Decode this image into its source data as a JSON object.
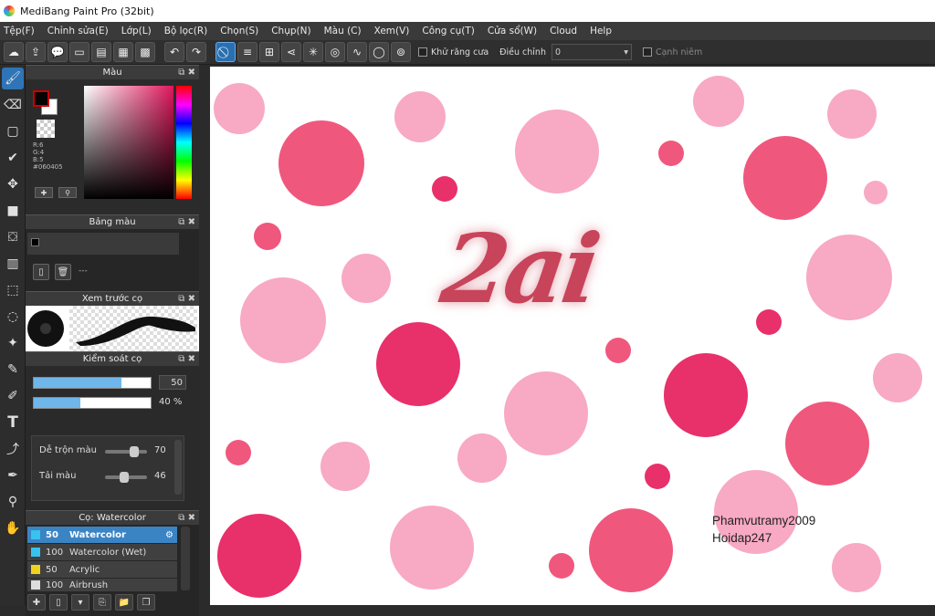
{
  "window": {
    "title": "MediBang Paint Pro (32bit)"
  },
  "menu": [
    "Tệp(F)",
    "Chỉnh sửa(E)",
    "Lớp(L)",
    "Bộ lọc(R)",
    "Chọn(S)",
    "Chụp(N)",
    "Màu (C)",
    "Xem(V)",
    "Công cụ(T)",
    "Cửa sổ(W)",
    "Cloud",
    "Help"
  ],
  "toolbar": {
    "antialias_label": "Khử răng cưa",
    "adjust_label": "Điều chỉnh",
    "adjust_value": "0",
    "edge_label": "Cạnh niêm"
  },
  "panels": {
    "color": {
      "title": "Màu",
      "r": "R:6",
      "g": "G:4",
      "b": "B:5",
      "hex": "#060405",
      "fg": "#060405",
      "bg": "#ffffff"
    },
    "palette": {
      "title": "Bảng màu",
      "dash": "---"
    },
    "brush_preview": {
      "title": "Xem trước cọ"
    },
    "brush_control": {
      "title": "Kiểm soát cọ",
      "size_value": "50",
      "opacity_value": "40 %",
      "size_fraction": 0.75,
      "opacity_fraction": 0.4,
      "blend_label": "Dễ trộn màu",
      "blend_value": "70",
      "blend_fraction": 0.7,
      "reload_label": "Tải màu",
      "reload_value": "46",
      "reload_fraction": 0.46
    },
    "brushes": {
      "title": "Cọ: Watercolor",
      "items": [
        {
          "size": "50",
          "name": "Watercolor",
          "color": "#37c2ef"
        },
        {
          "size": "100",
          "name": "Watercolor (Wet)",
          "color": "#37c2ef"
        },
        {
          "size": "50",
          "name": "Acrylic",
          "color": "#f0d21e"
        },
        {
          "size": "100",
          "name": "Airbrush",
          "color": "#dddddd"
        }
      ]
    }
  },
  "canvas": {
    "lettering": "2ai",
    "signature_line1": "Phamvutramy2009",
    "signature_line2": "Hoidap247",
    "colors": {
      "light": "#f8a9c4",
      "mid": "#f0577d",
      "deep": "#e8306a"
    }
  }
}
